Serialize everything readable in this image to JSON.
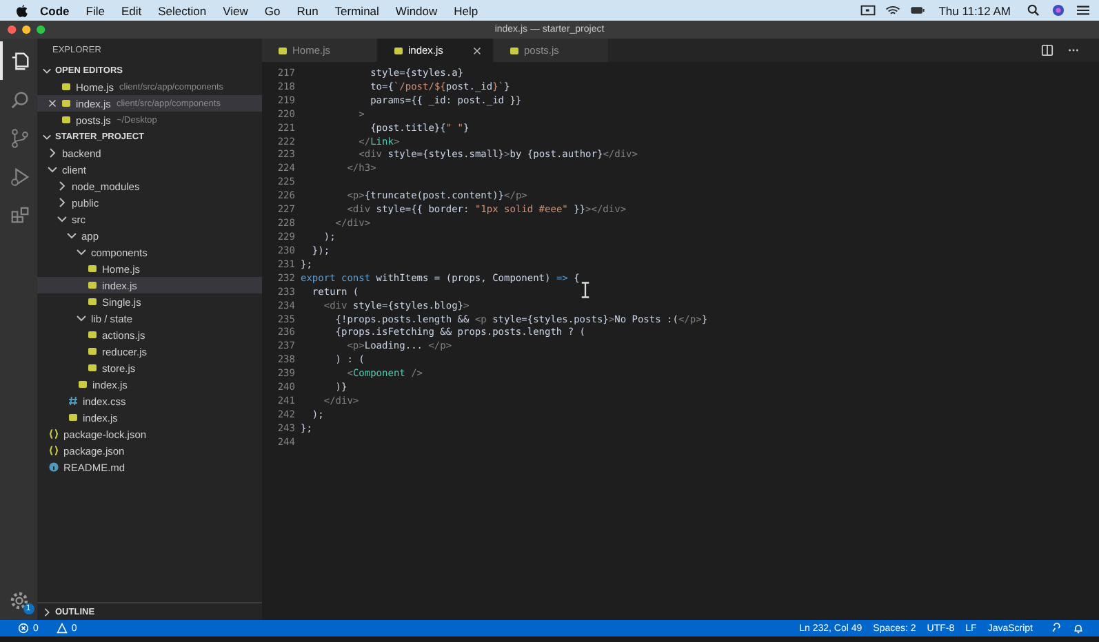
{
  "menu_bar": {
    "app": "Code",
    "menus": [
      "File",
      "Edit",
      "Selection",
      "View",
      "Go",
      "Run",
      "Terminal",
      "Window",
      "Help"
    ],
    "clock": "Thu 11:12 AM"
  },
  "window": {
    "title": "index.js — starter_project"
  },
  "activity_bar": {
    "items": [
      {
        "kind": "explorer",
        "selected": true
      },
      {
        "kind": "search",
        "selected": false
      },
      {
        "kind": "source-control",
        "selected": false
      },
      {
        "kind": "run",
        "selected": false
      },
      {
        "kind": "extensions",
        "selected": false
      }
    ],
    "settings_badge": "1"
  },
  "explorer": {
    "title": "EXPLORER",
    "open_editors": {
      "title": "OPEN EDITORS",
      "expanded": true,
      "items": [
        {
          "name": "Home.js",
          "path": "client/src/app/components",
          "selected": false
        },
        {
          "name": "index.js",
          "path": "client/src/app/components",
          "selected": true
        },
        {
          "name": "posts.js",
          "path": "~/Desktop",
          "selected": false
        }
      ]
    },
    "project": {
      "title": "STARTER_PROJECT",
      "expanded": true,
      "tree": [
        {
          "name": "backend",
          "kind": "folder",
          "expanded": false
        },
        {
          "name": "client",
          "kind": "folder",
          "expanded": true,
          "children": [
            {
              "name": "node_modules",
              "kind": "folder",
              "expanded": false
            },
            {
              "name": "public",
              "kind": "folder",
              "expanded": false
            },
            {
              "name": "src",
              "kind": "folder",
              "expanded": true,
              "children": [
                {
                  "name": "app",
                  "kind": "folder",
                  "expanded": true,
                  "children": [
                    {
                      "name": "components",
                      "kind": "folder",
                      "expanded": true,
                      "children": [
                        {
                          "name": "Home.js",
                          "kind": "js",
                          "selected": false
                        },
                        {
                          "name": "index.js",
                          "kind": "js",
                          "selected": true
                        },
                        {
                          "name": "Single.js",
                          "kind": "js",
                          "selected": false
                        }
                      ]
                    },
                    {
                      "name": "lib / state",
                      "kind": "folder",
                      "expanded": true,
                      "children": [
                        {
                          "name": "actions.js",
                          "kind": "js",
                          "selected": false
                        },
                        {
                          "name": "reducer.js",
                          "kind": "js",
                          "selected": false
                        },
                        {
                          "name": "store.js",
                          "kind": "js",
                          "selected": false
                        }
                      ]
                    },
                    {
                      "name": "index.js",
                      "kind": "js",
                      "selected": false
                    }
                  ]
                },
                {
                  "name": "index.css",
                  "kind": "css",
                  "selected": false
                },
                {
                  "name": "index.js",
                  "kind": "js",
                  "selected": false
                }
              ]
            }
          ]
        },
        {
          "name": "package-lock.json",
          "kind": "json",
          "selected": false
        },
        {
          "name": "package.json",
          "kind": "json",
          "selected": false
        },
        {
          "name": "README.md",
          "kind": "info",
          "selected": false
        }
      ]
    },
    "outline": {
      "title": "OUTLINE",
      "expanded": false
    }
  },
  "tabs": [
    {
      "label": "Home.js",
      "selected": false
    },
    {
      "label": "index.js",
      "selected": true
    },
    {
      "label": "posts.js",
      "selected": false
    }
  ],
  "editor": {
    "lines": [
      {
        "number": "217",
        "tokens": [
          {
            "kind": "txt",
            "text": "            style={styles.a}"
          }
        ]
      },
      {
        "number": "218",
        "tokens": [
          {
            "kind": "txt",
            "text": "            to={"
          },
          {
            "kind": "str",
            "text": "`/post/${"
          },
          {
            "kind": "txt",
            "text": "post._id"
          },
          {
            "kind": "str",
            "text": "}`"
          },
          {
            "kind": "txt",
            "text": "}"
          }
        ]
      },
      {
        "number": "219",
        "tokens": [
          {
            "kind": "txt",
            "text": "            params={{ _id: post._id }}"
          }
        ]
      },
      {
        "number": "220",
        "tokens": [
          {
            "kind": "tag",
            "text": "          >"
          }
        ]
      },
      {
        "number": "221",
        "tokens": [
          {
            "kind": "txt",
            "text": "            {post.title}{"
          },
          {
            "kind": "str",
            "text": "\" \""
          },
          {
            "kind": "txt",
            "text": "}"
          }
        ]
      },
      {
        "number": "222",
        "tokens": [
          {
            "kind": "tag",
            "text": "          </"
          },
          {
            "kind": "comp",
            "text": "Link"
          },
          {
            "kind": "tag",
            "text": ">"
          }
        ]
      },
      {
        "number": "223",
        "tokens": [
          {
            "kind": "tag",
            "text": "          <div"
          },
          {
            "kind": "txt",
            "text": " style={styles.small}"
          },
          {
            "kind": "tag",
            "text": ">"
          },
          {
            "kind": "txt",
            "text": "by {post.author}"
          },
          {
            "kind": "tag",
            "text": "</div>"
          }
        ]
      },
      {
        "number": "224",
        "tokens": [
          {
            "kind": "tag",
            "text": "        </h3>"
          }
        ]
      },
      {
        "number": "225"
      },
      {
        "number": "226",
        "tokens": [
          {
            "kind": "tag",
            "text": "        <p>"
          },
          {
            "kind": "txt",
            "text": "{truncate(post.content)}"
          },
          {
            "kind": "tag",
            "text": "</p>"
          }
        ]
      },
      {
        "number": "227",
        "tokens": [
          {
            "kind": "tag",
            "text": "        <div"
          },
          {
            "kind": "txt",
            "text": " style={{ border: "
          },
          {
            "kind": "str",
            "text": "\"1px solid #eee\""
          },
          {
            "kind": "txt",
            "text": " }}"
          },
          {
            "kind": "tag",
            "text": "></div>"
          }
        ]
      },
      {
        "number": "228",
        "tokens": [
          {
            "kind": "tag",
            "text": "      </div>"
          }
        ]
      },
      {
        "number": "229",
        "tokens": [
          {
            "kind": "txt",
            "text": "    );"
          }
        ]
      },
      {
        "number": "230",
        "tokens": [
          {
            "kind": "txt",
            "text": "  });"
          }
        ]
      },
      {
        "number": "231",
        "tokens": [
          {
            "kind": "txt",
            "text": "};"
          }
        ]
      },
      {
        "number": "232",
        "tokens": [
          {
            "kind": "kw",
            "text": "export const"
          },
          {
            "kind": "txt",
            "text": " withItems = (props, Component) "
          },
          {
            "kind": "kw",
            "text": "=>"
          },
          {
            "kind": "txt",
            "text": " {"
          }
        ]
      },
      {
        "number": "233",
        "tokens": [
          {
            "kind": "txt",
            "text": "  return ("
          }
        ]
      },
      {
        "number": "234",
        "tokens": [
          {
            "kind": "tag",
            "text": "    <div"
          },
          {
            "kind": "txt",
            "text": " style={styles.blog}"
          },
          {
            "kind": "tag",
            "text": ">"
          }
        ]
      },
      {
        "number": "235",
        "tokens": [
          {
            "kind": "txt",
            "text": "      {!props.posts.length && "
          },
          {
            "kind": "tag",
            "text": "<p"
          },
          {
            "kind": "txt",
            "text": " style={styles.posts}"
          },
          {
            "kind": "tag",
            "text": ">"
          },
          {
            "kind": "txt",
            "text": "No Posts :("
          },
          {
            "kind": "tag",
            "text": "</p>"
          },
          {
            "kind": "txt",
            "text": "}"
          }
        ]
      },
      {
        "number": "236",
        "tokens": [
          {
            "kind": "txt",
            "text": "      {props.isFetching && props.posts.length ? ("
          }
        ]
      },
      {
        "number": "237",
        "tokens": [
          {
            "kind": "tag",
            "text": "        <p>"
          },
          {
            "kind": "txt",
            "text": "Loading... "
          },
          {
            "kind": "tag",
            "text": "</p>"
          }
        ]
      },
      {
        "number": "238",
        "tokens": [
          {
            "kind": "txt",
            "text": "      ) : ("
          }
        ]
      },
      {
        "number": "239",
        "tokens": [
          {
            "kind": "tag",
            "text": "        <"
          },
          {
            "kind": "comp",
            "text": "Component"
          },
          {
            "kind": "tag",
            "text": " />"
          }
        ]
      },
      {
        "number": "240",
        "tokens": [
          {
            "kind": "txt",
            "text": "      )}"
          }
        ]
      },
      {
        "number": "241",
        "tokens": [
          {
            "kind": "tag",
            "text": "    </div>"
          }
        ]
      },
      {
        "number": "242",
        "tokens": [
          {
            "kind": "txt",
            "text": "  );"
          }
        ]
      },
      {
        "number": "243",
        "tokens": [
          {
            "kind": "txt",
            "text": "};"
          }
        ]
      },
      {
        "number": "244"
      }
    ]
  },
  "status_bar": {
    "errors": "0",
    "warnings": "0",
    "position": "Ln 232, Col 49",
    "indent": "Spaces: 2",
    "encoding": "UTF-8",
    "eol": "LF",
    "language": "JavaScript"
  }
}
